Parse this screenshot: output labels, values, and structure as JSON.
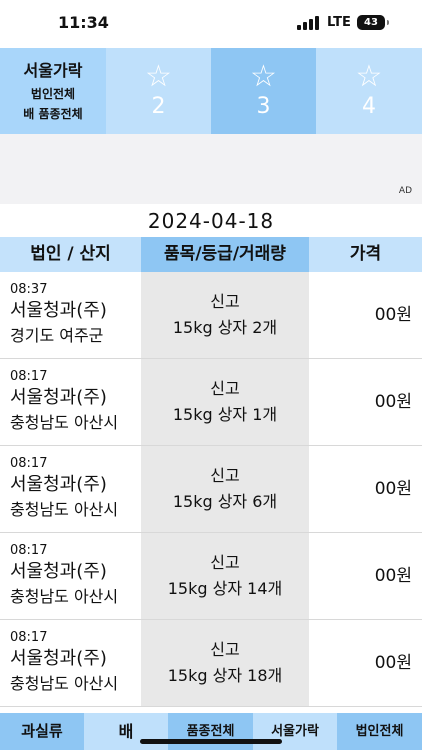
{
  "status_bar": {
    "time": "11:34",
    "network": "LTE",
    "battery": "43"
  },
  "header": {
    "market": "서울가락",
    "corporation": "법인전체",
    "item_variety": "배 품종전체",
    "rating_tabs": [
      {
        "icon": "star-icon",
        "label": "2"
      },
      {
        "icon": "star-icon",
        "label": "3"
      },
      {
        "icon": "star-icon",
        "label": "4"
      }
    ]
  },
  "ad": {
    "label": "AD"
  },
  "date": "2024-04-18",
  "table": {
    "columns": [
      "법인 / 산지",
      "품목/등급/거래량",
      "가격"
    ],
    "rows": [
      {
        "time": "08:37",
        "corp": "서울청과(주)",
        "origin": "경기도 여주군",
        "grade": "신고",
        "volume": "15kg 상자 2개",
        "price": "00원"
      },
      {
        "time": "08:17",
        "corp": "서울청과(주)",
        "origin": "충청남도 아산시",
        "grade": "신고",
        "volume": "15kg 상자 1개",
        "price": "00원"
      },
      {
        "time": "08:17",
        "corp": "서울청과(주)",
        "origin": "충청남도 아산시",
        "grade": "신고",
        "volume": "15kg 상자 6개",
        "price": "00원"
      },
      {
        "time": "08:17",
        "corp": "서울청과(주)",
        "origin": "충청남도 아산시",
        "grade": "신고",
        "volume": "15kg 상자 14개",
        "price": "00원"
      },
      {
        "time": "08:17",
        "corp": "서울청과(주)",
        "origin": "충청남도 아산시",
        "grade": "신고",
        "volume": "15kg 상자 18개",
        "price": "00원"
      }
    ]
  },
  "bottom_bar": {
    "category": "과실류",
    "item": "배",
    "variety": "품종전체",
    "market": "서울가락",
    "corporation": "법인전체"
  },
  "colors": {
    "accent_dark": "#8ec6f3",
    "accent_light": "#bfe0fb",
    "header_info": "#a9d6fa"
  }
}
